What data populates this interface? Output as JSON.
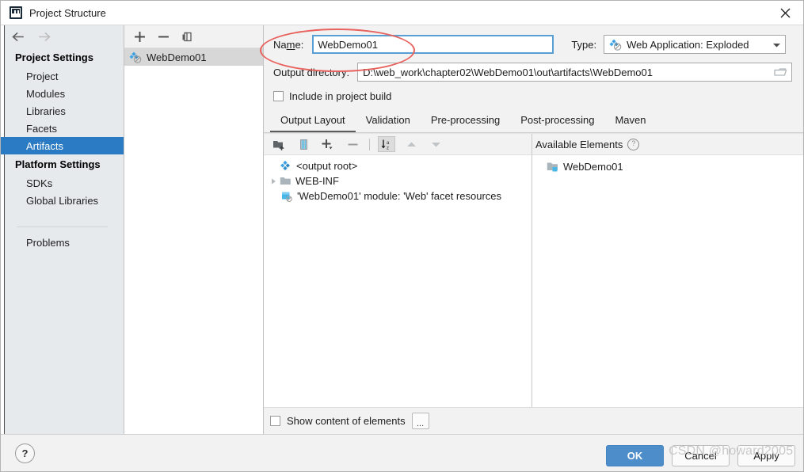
{
  "window": {
    "title": "Project Structure",
    "app_icon": "intellij-idea-icon",
    "close_label": "✕"
  },
  "nav": {
    "back_icon": "arrow-left-icon",
    "forward_icon": "arrow-right-icon"
  },
  "sidebar": {
    "groups": [
      {
        "title": "Project Settings",
        "items": [
          {
            "label": "Project",
            "selected": false
          },
          {
            "label": "Modules",
            "selected": false
          },
          {
            "label": "Libraries",
            "selected": false
          },
          {
            "label": "Facets",
            "selected": false
          },
          {
            "label": "Artifacts",
            "selected": true
          }
        ]
      },
      {
        "title": "Platform Settings",
        "items": [
          {
            "label": "SDKs",
            "selected": false
          },
          {
            "label": "Global Libraries",
            "selected": false
          }
        ]
      }
    ],
    "problems_label": "Problems",
    "selected_color": "#2b7bc4"
  },
  "artifact_list": {
    "toolbar": [
      {
        "name": "add-artifact-button",
        "icon": "plus-icon"
      },
      {
        "name": "remove-artifact-button",
        "icon": "minus-icon"
      },
      {
        "name": "copy-artifact-button",
        "icon": "copy-icon"
      }
    ],
    "items": [
      {
        "label": "WebDemo01",
        "icon": "artifact-icon",
        "selected": true
      }
    ]
  },
  "form": {
    "name_label": "Name:",
    "name_value": "WebDemo01",
    "type_label": "Type:",
    "type_value": "Web Application: Exploded",
    "type_icon": "artifact-icon",
    "type_caret": "chevron-down-icon",
    "output_dir_label": "Output directory:",
    "output_dir_value": "D:\\web_work\\chapter02\\WebDemo01\\out\\artifacts\\WebDemo01",
    "folder_icon": "folder-browse-icon",
    "include_in_build_label": "Include in project build",
    "include_in_build_checked": false
  },
  "tabs": [
    {
      "label": "Output Layout",
      "active": true
    },
    {
      "label": "Validation",
      "active": false
    },
    {
      "label": "Pre-processing",
      "active": false
    },
    {
      "label": "Post-processing",
      "active": false
    },
    {
      "label": "Maven",
      "active": false
    }
  ],
  "layout_toolbar": [
    {
      "name": "add-directory-button",
      "icon": "folder-add-icon",
      "pressed": false
    },
    {
      "name": "create-archive-button",
      "icon": "archive-icon",
      "pressed": false
    },
    {
      "name": "add-copy-button",
      "icon": "plus-dropdown-icon",
      "pressed": false
    },
    {
      "name": "remove-button",
      "icon": "minus-icon",
      "pressed": false
    },
    {
      "name": "sort-button",
      "icon": "sort-az-icon",
      "pressed": true
    },
    {
      "name": "move-up-button",
      "icon": "triangle-up-icon",
      "pressed": false
    },
    {
      "name": "move-down-button",
      "icon": "triangle-down-icon",
      "pressed": false
    }
  ],
  "output_tree": [
    {
      "label": "<output root>",
      "icon": "artifact-icon",
      "indent": 0,
      "twisty": "none"
    },
    {
      "label": "WEB-INF",
      "icon": "folder-icon",
      "indent": 0,
      "twisty": "collapsed"
    },
    {
      "label": "'WebDemo01' module: 'Web' facet resources",
      "icon": "module-facet-icon",
      "indent": 1,
      "twisty": "none"
    }
  ],
  "available": {
    "title": "Available Elements",
    "help_icon": "question-mark-icon",
    "help_glyph": "?",
    "items": [
      {
        "label": "WebDemo01",
        "icon": "module-icon"
      }
    ]
  },
  "bottom": {
    "show_content_label": "Show content of elements",
    "show_content_checked": false,
    "dots_label": "...",
    "help_glyph": "?"
  },
  "footer": {
    "ok_label": "OK",
    "cancel_label": "Cancel",
    "apply_label": "Apply"
  },
  "annotations": {
    "ellipse_color": "#e8625e",
    "watermark": "CSDN @howard2005"
  }
}
